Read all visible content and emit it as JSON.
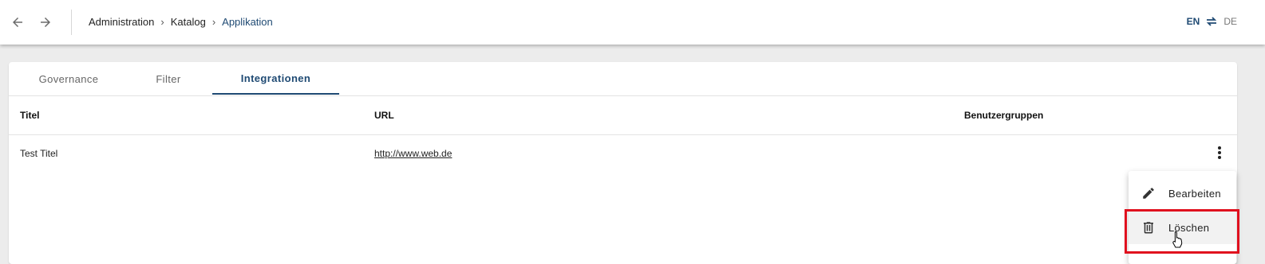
{
  "breadcrumb": {
    "items": [
      "Administration",
      "Katalog",
      "Applikation"
    ],
    "separator": "›"
  },
  "language": {
    "current": "EN",
    "other": "DE"
  },
  "tabs": [
    {
      "label": "Governance",
      "active": false
    },
    {
      "label": "Filter",
      "active": false
    },
    {
      "label": "Integrationen",
      "active": true
    }
  ],
  "table": {
    "headers": [
      "Titel",
      "URL",
      "Benutzergruppen"
    ],
    "rows": [
      {
        "titel": "Test Titel",
        "url": "http://www.web.de",
        "benutzergruppen": ""
      }
    ]
  },
  "context_menu": {
    "items": [
      {
        "label": "Bearbeiten",
        "icon": "pencil-icon"
      },
      {
        "label": "Löschen",
        "icon": "trash-icon"
      }
    ]
  },
  "colors": {
    "accent": "#1f4a73",
    "highlight": "#e0101e"
  }
}
